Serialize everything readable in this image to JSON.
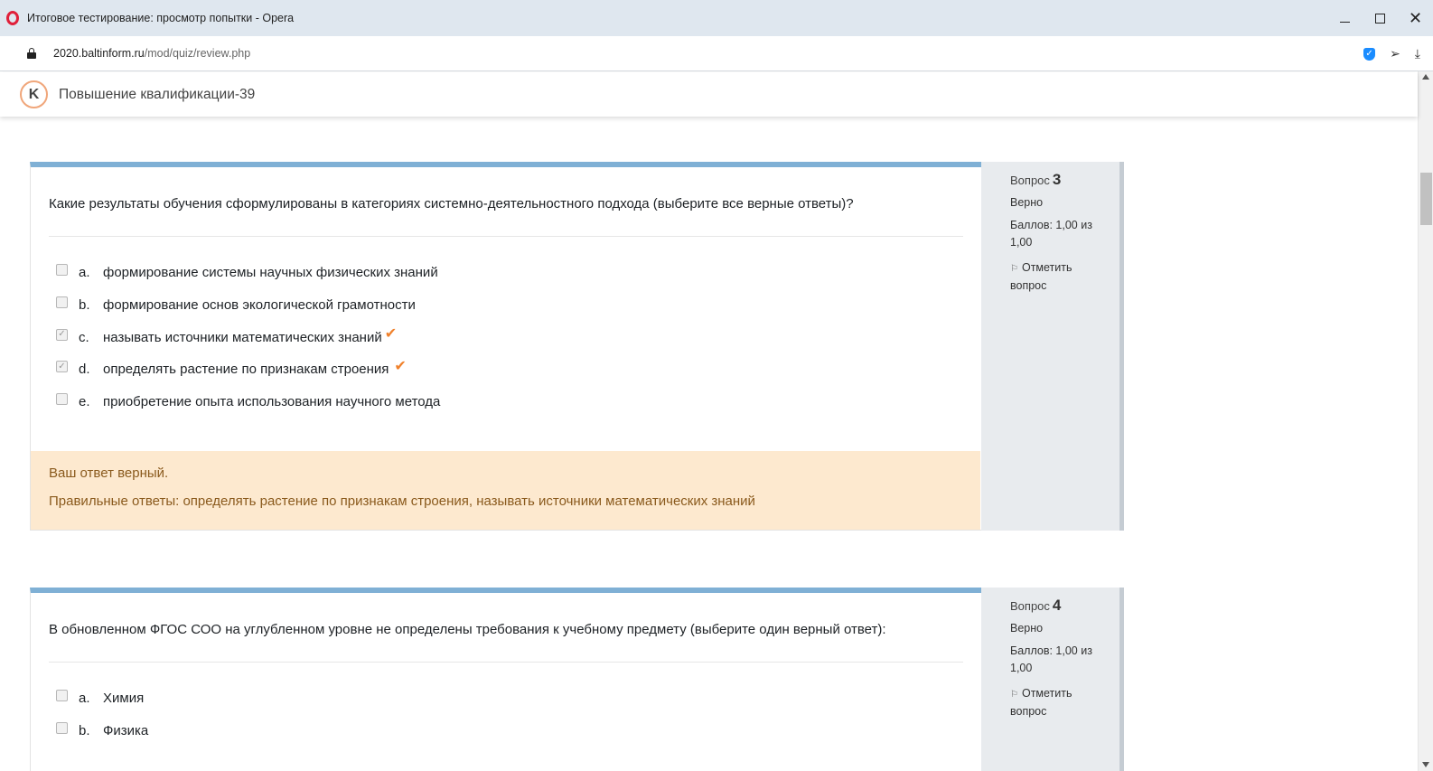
{
  "window": {
    "title": "Итоговое тестирование: просмотр попытки - Opera"
  },
  "address": {
    "url_host": "2020.baltinform.ru",
    "url_path": "/mod/quiz/review.php"
  },
  "site": {
    "name": "Повышение квалификации-39"
  },
  "questions": [
    {
      "label": "Вопрос",
      "number": "3",
      "state": "Верно",
      "grade": "Баллов: 1,00 из 1,00",
      "flag": "Отметить вопрос",
      "text": "Какие результаты обучения сформулированы в категориях системно-деятельностного подхода (выберите все верные ответы)?",
      "answers": [
        {
          "letter": "a.",
          "text": "формирование системы научных физических знаний",
          "checked": false,
          "correct": false
        },
        {
          "letter": "b.",
          "text": "формирование основ экологической грамотности",
          "checked": false,
          "correct": false
        },
        {
          "letter": "c.",
          "text": "называть источники математических знаний",
          "checked": true,
          "correct": true
        },
        {
          "letter": "d.",
          "text": "определять растение по признакам строения",
          "checked": true,
          "correct": true
        },
        {
          "letter": "e.",
          "text": "приобретение опыта использования научного метода",
          "checked": false,
          "correct": false
        }
      ],
      "feedback_main": "Ваш ответ верный.",
      "feedback_right": "Правильные ответы: определять растение по признакам строения, называть источники математических знаний"
    },
    {
      "label": "Вопрос",
      "number": "4",
      "state": "Верно",
      "grade": "Баллов: 1,00 из 1,00",
      "flag": "Отметить вопрос",
      "text": "В обновленном ФГОС СОО на углубленном уровне не определены требования к учебному предмету (выберите один верный ответ):",
      "answers": [
        {
          "letter": "a.",
          "text": "Химия",
          "checked": false,
          "correct": false
        },
        {
          "letter": "b.",
          "text": "Физика",
          "checked": false,
          "correct": false
        }
      ]
    }
  ],
  "colors": {
    "accent_bar": "#7fb0d5",
    "feedback_bg": "#fde9cf",
    "feedback_text": "#8a5a1d",
    "tick": "#f0812b"
  }
}
